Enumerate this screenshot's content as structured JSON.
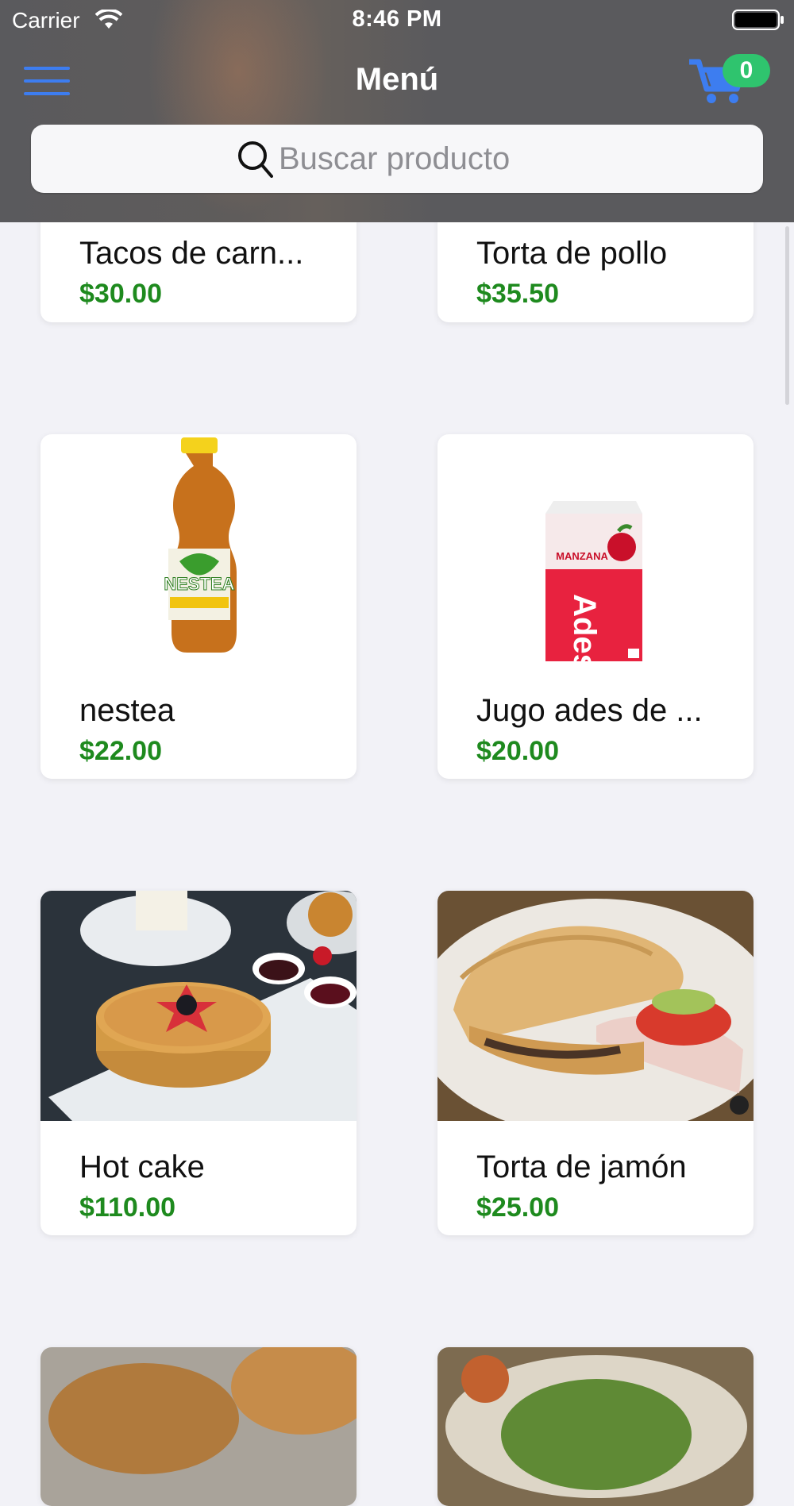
{
  "status_bar": {
    "carrier": "Carrier",
    "time": "8:46 PM"
  },
  "header": {
    "title": "Menú",
    "cart_count": "0",
    "search_placeholder": "Buscar producto"
  },
  "products": [
    {
      "name": "Tacos de carn...",
      "price": "$30.00"
    },
    {
      "name": "Torta de pollo",
      "price": "$35.50"
    },
    {
      "name": "nestea",
      "price": "$22.00"
    },
    {
      "name": "Jugo ades de ...",
      "price": "$20.00"
    },
    {
      "name": "Hot cake",
      "price": "$110.00"
    },
    {
      "name": "Torta de jamón",
      "price": "$25.00"
    }
  ],
  "image_labels": {
    "nestea_brand": "NESTEA",
    "ades_brand": "Ades",
    "ades_flavor": "MANZANA"
  },
  "colors": {
    "accent": "#3d7df0",
    "badge": "#2fc46e",
    "price": "#1e8a1e"
  }
}
